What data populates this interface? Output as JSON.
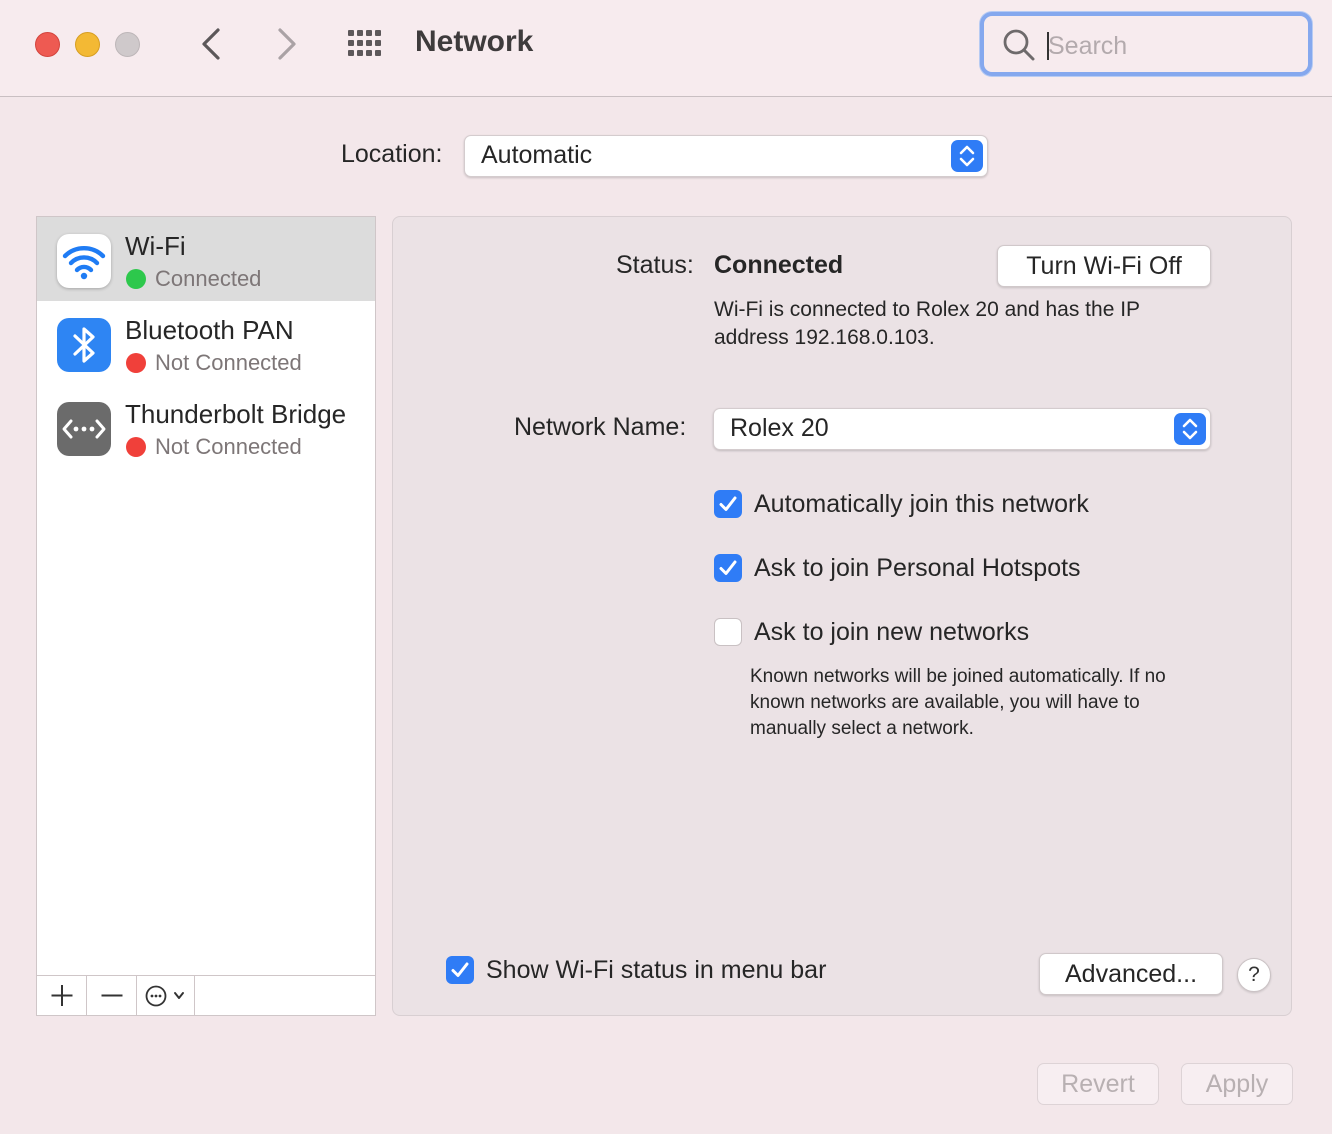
{
  "window": {
    "title": "Network",
    "search_placeholder": "Search"
  },
  "location": {
    "label": "Location:",
    "value": "Automatic"
  },
  "services": [
    {
      "name": "Wi-Fi",
      "status": "Connected",
      "status_color": "#2dc84c",
      "icon": "wifi-icon",
      "selected": true
    },
    {
      "name": "Bluetooth PAN",
      "status": "Not Connected",
      "status_color": "#f0403a",
      "icon": "bluetooth-icon",
      "selected": false
    },
    {
      "name": "Thunderbolt Bridge",
      "status": "Not Connected",
      "status_color": "#f0403a",
      "icon": "thunderbolt-bridge-icon",
      "selected": false
    }
  ],
  "sidebar_toolbar": {
    "add_icon": "plus-icon",
    "remove_icon": "minus-icon",
    "action_icon": "ellipsis-circle-icon"
  },
  "detail": {
    "status_label": "Status:",
    "status_value": "Connected",
    "toggle_button": "Turn Wi-Fi Off",
    "status_description": "Wi-Fi is connected to Rolex 20 and has the IP address 192.168.0.103.",
    "network_name_label": "Network Name:",
    "network_name_value": "Rolex 20",
    "options": [
      {
        "label": "Automatically join this network",
        "checked": true
      },
      {
        "label": "Ask to join Personal Hotspots",
        "checked": true
      },
      {
        "label": "Ask to join new networks",
        "checked": false
      }
    ],
    "hint": "Known networks will be joined automatically. If no known networks are available, you will have to manually select a network.",
    "show_status_label": "Show Wi-Fi status in menu bar",
    "show_status_checked": true,
    "advanced_button": "Advanced...",
    "help_button": "?"
  },
  "footer": {
    "revert_button": "Revert",
    "apply_button": "Apply"
  },
  "colors": {
    "accent": "#2f7cf6",
    "connected": "#2dc84c",
    "not_connected": "#f0403a"
  }
}
